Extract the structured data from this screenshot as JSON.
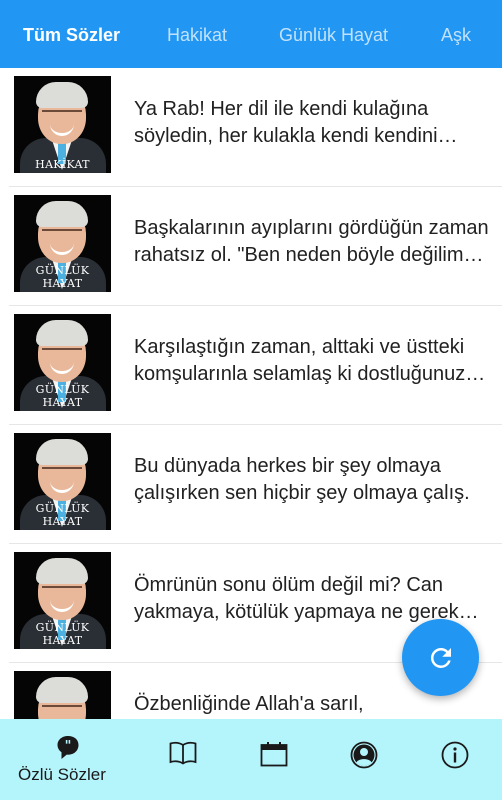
{
  "tabs": [
    {
      "label": "Tüm Sözler",
      "active": true
    },
    {
      "label": "Hakikat",
      "active": false
    },
    {
      "label": "Günlük Hayat",
      "active": false
    },
    {
      "label": "Aşk",
      "active": false
    }
  ],
  "quotes": [
    {
      "category": "HAKİKAT",
      "text": "Ya Rab! Her dil ile kendi kulağına söyledin, her kulakla kendi kendini dinledin."
    },
    {
      "category": "GÜNLÜK HAYAT",
      "text": "Başkalarının ayıplarını gördüğün zaman rahatsız ol. \"Ben neden böyle değilim\" de."
    },
    {
      "category": "GÜNLÜK HAYAT",
      "text": "Karşılaştığın zaman, alttaki ve üstteki komşularınla selamlaş ki dostluğunuz artsın."
    },
    {
      "category": "GÜNLÜK HAYAT",
      "text": "Bu dünyada herkes bir şey olmaya çalışırken sen hiçbir şey olmaya çalış."
    },
    {
      "category": "GÜNLÜK HAYAT",
      "text": "Ömrünün sonu ölüm değil mi? Can yakmaya, kötülük yapmaya ne gerek var."
    },
    {
      "category": "",
      "text": "Özbenliğinde Allah'a sarıl,"
    }
  ],
  "fab": {
    "icon": "refresh-icon"
  },
  "bottom_nav": [
    {
      "icon": "quote-bubble-icon",
      "label": "Özlü Sözler",
      "active": true
    },
    {
      "icon": "book-icon",
      "label": ""
    },
    {
      "icon": "calendar-icon",
      "label": ""
    },
    {
      "icon": "user-icon",
      "label": ""
    },
    {
      "icon": "info-icon",
      "label": ""
    }
  ],
  "colors": {
    "primary": "#2196F3",
    "bottom_bar": "#B4F5FC",
    "text": "#212121"
  }
}
